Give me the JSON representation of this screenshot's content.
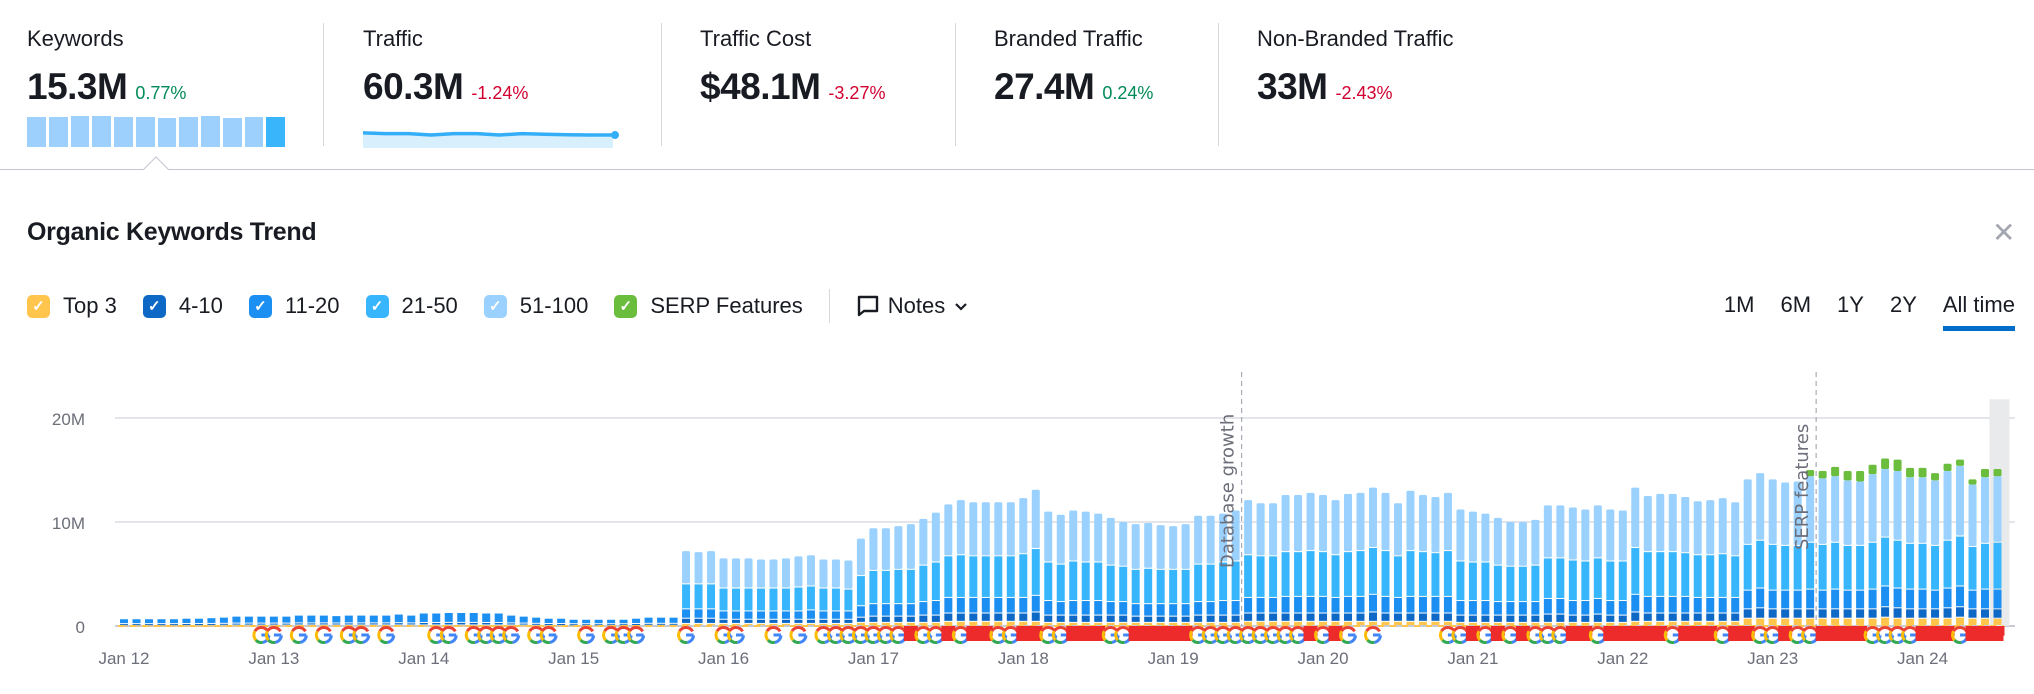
{
  "metrics": [
    {
      "label": "Keywords",
      "value": "15.3M",
      "change": "0.77%",
      "trend": "up",
      "sparkline": [
        0.93,
        0.95,
        0.97,
        0.97,
        0.94,
        0.94,
        0.92,
        0.95,
        0.97,
        0.91,
        0.93,
        0.94
      ]
    },
    {
      "label": "Traffic",
      "value": "60.3M",
      "change": "-1.24%",
      "trend": "down",
      "sparkline": [
        0.92,
        0.9,
        0.9,
        0.86,
        0.9,
        0.9,
        0.86,
        0.9,
        0.88,
        0.87,
        0.86,
        0.86
      ]
    },
    {
      "label": "Traffic Cost",
      "value": "$48.1M",
      "change": "-3.27%",
      "trend": "down"
    },
    {
      "label": "Branded Traffic",
      "value": "27.4M",
      "change": "0.24%",
      "trend": "up"
    },
    {
      "label": "Non-Branded Traffic",
      "value": "33M",
      "change": "-2.43%",
      "trend": "down"
    }
  ],
  "panel": {
    "title": "Organic Keywords Trend",
    "close_icon": "close-icon"
  },
  "legend": [
    {
      "label": "Top 3",
      "color": "#ffc54d",
      "checked": true
    },
    {
      "label": "4-10",
      "color": "#0e68c6",
      "checked": true
    },
    {
      "label": "11-20",
      "color": "#1c8ff2",
      "checked": true
    },
    {
      "label": "21-50",
      "color": "#38b6fd",
      "checked": true
    },
    {
      "label": "51-100",
      "color": "#9ad1fe",
      "checked": true
    },
    {
      "label": "SERP Features",
      "color": "#6bbd3e",
      "checked": true
    }
  ],
  "notes": {
    "label": "Notes",
    "icon": "comment-icon"
  },
  "ranges": [
    {
      "label": "1M"
    },
    {
      "label": "6M"
    },
    {
      "label": "1Y"
    },
    {
      "label": "2Y"
    },
    {
      "label": "All time",
      "active": true
    }
  ],
  "colors": {
    "flag": "#ee2b2b",
    "google_blue": "#4285f4",
    "google_red": "#ea4335",
    "google_yellow": "#fbbc05",
    "google_green": "#34a853"
  },
  "chart_data": {
    "type": "bar",
    "stacked": true,
    "period": "monthly",
    "first_month": "Jan 2012",
    "ylim": [
      0,
      22
    ],
    "y_unit": "M",
    "y_ticks": [
      "0",
      "10M",
      "20M"
    ],
    "x_ticks": [
      "Jan 12",
      "Jan 13",
      "Jan 14",
      "Jan 15",
      "Jan 16",
      "Jan 17",
      "Jan 18",
      "Jan 19",
      "Jan 20",
      "Jan 21",
      "Jan 22",
      "Jan 23",
      "Jan 24"
    ],
    "grid": true,
    "annotations": [
      {
        "label": "Database growth",
        "month": "Jun 2019"
      },
      {
        "label": "SERP features",
        "month": "Apr 2023"
      }
    ],
    "series": [
      {
        "name": "Top 3",
        "values": [
          0.05,
          0.05,
          0.05,
          0.05,
          0.05,
          0.05,
          0.05,
          0.05,
          0.05,
          0.05,
          0.05,
          0.05,
          0.05,
          0.05,
          0.05,
          0.05,
          0.05,
          0.05,
          0.05,
          0.05,
          0.05,
          0.05,
          0.05,
          0.05,
          0.05,
          0.05,
          0.05,
          0.05,
          0.05,
          0.05,
          0.05,
          0.05,
          0.05,
          0.05,
          0.05,
          0.05,
          0.05,
          0.05,
          0.05,
          0.05,
          0.05,
          0.05,
          0.05,
          0.05,
          0.05,
          0.2,
          0.2,
          0.2,
          0.2,
          0.2,
          0.2,
          0.2,
          0.2,
          0.2,
          0.2,
          0.2,
          0.2,
          0.2,
          0.2,
          0.3,
          0.3,
          0.3,
          0.3,
          0.3,
          0.3,
          0.3,
          0.4,
          0.4,
          0.4,
          0.4,
          0.4,
          0.4,
          0.4,
          0.4,
          0.3,
          0.3,
          0.3,
          0.3,
          0.3,
          0.3,
          0.3,
          0.3,
          0.3,
          0.3,
          0.3,
          0.3,
          0.3,
          0.3,
          0.3,
          0.3,
          0.4,
          0.4,
          0.4,
          0.4,
          0.4,
          0.4,
          0.4,
          0.4,
          0.4,
          0.4,
          0.4,
          0.4,
          0.4,
          0.4,
          0.4,
          0.4,
          0.4,
          0.3,
          0.3,
          0.3,
          0.3,
          0.3,
          0.3,
          0.3,
          0.3,
          0.3,
          0.3,
          0.3,
          0.3,
          0.3,
          0.3,
          0.4,
          0.4,
          0.4,
          0.4,
          0.4,
          0.4,
          0.4,
          0.4,
          0.4,
          0.7,
          0.7,
          0.7,
          0.7,
          0.7,
          0.7,
          0.7,
          0.7,
          0.7,
          0.7,
          0.7,
          0.8,
          0.7,
          0.7,
          0.7,
          0.7,
          0.7,
          0.8,
          0.7,
          0.7,
          0.7
        ]
      },
      {
        "name": "4-10",
        "values": [
          0.13,
          0.13,
          0.13,
          0.13,
          0.13,
          0.14,
          0.14,
          0.15,
          0.16,
          0.18,
          0.18,
          0.18,
          0.18,
          0.18,
          0.2,
          0.2,
          0.2,
          0.19,
          0.2,
          0.2,
          0.2,
          0.2,
          0.22,
          0.2,
          0.24,
          0.24,
          0.25,
          0.25,
          0.25,
          0.24,
          0.24,
          0.2,
          0.18,
          0.16,
          0.14,
          0.14,
          0.12,
          0.12,
          0.12,
          0.12,
          0.12,
          0.14,
          0.16,
          0.16,
          0.16,
          0.5,
          0.5,
          0.5,
          0.4,
          0.4,
          0.4,
          0.4,
          0.4,
          0.4,
          0.4,
          0.4,
          0.4,
          0.4,
          0.4,
          0.5,
          0.6,
          0.6,
          0.6,
          0.6,
          0.7,
          0.7,
          0.8,
          0.8,
          0.8,
          0.8,
          0.8,
          0.8,
          0.8,
          0.9,
          0.7,
          0.7,
          0.7,
          0.7,
          0.7,
          0.7,
          0.7,
          0.6,
          0.6,
          0.6,
          0.6,
          0.6,
          0.7,
          0.7,
          0.7,
          0.7,
          0.8,
          0.8,
          0.8,
          0.8,
          0.8,
          0.8,
          0.8,
          0.8,
          0.8,
          0.8,
          0.9,
          0.8,
          0.8,
          0.8,
          0.8,
          0.8,
          0.8,
          0.7,
          0.7,
          0.7,
          0.7,
          0.7,
          0.7,
          0.7,
          0.8,
          0.8,
          0.7,
          0.7,
          0.8,
          0.7,
          0.7,
          0.9,
          0.8,
          0.8,
          0.8,
          0.8,
          0.8,
          0.8,
          0.8,
          0.8,
          0.9,
          1.0,
          0.9,
          0.9,
          0.9,
          0.9,
          0.9,
          0.9,
          0.9,
          0.9,
          0.9,
          1.0,
          1.0,
          0.9,
          0.9,
          0.9,
          1.0,
          1.0,
          0.9,
          0.9,
          0.9
        ]
      },
      {
        "name": "11-20",
        "values": [
          0.47,
          0.47,
          0.47,
          0.47,
          0.47,
          0.51,
          0.51,
          0.55,
          0.59,
          0.67,
          0.67,
          0.67,
          0.67,
          0.67,
          0.75,
          0.75,
          0.75,
          0.71,
          0.75,
          0.75,
          0.75,
          0.75,
          0.83,
          0.75,
          0.91,
          0.91,
          0.95,
          0.95,
          0.95,
          0.91,
          0.91,
          0.75,
          0.67,
          0.59,
          0.51,
          0.51,
          0.43,
          0.43,
          0.43,
          0.43,
          0.43,
          0.51,
          0.59,
          0.59,
          0.59,
          0.9,
          0.9,
          0.9,
          0.8,
          0.8,
          0.8,
          0.8,
          0.8,
          0.8,
          0.8,
          0.9,
          0.8,
          0.8,
          0.8,
          1.1,
          1.2,
          1.2,
          1.2,
          1.2,
          1.3,
          1.4,
          1.5,
          1.5,
          1.5,
          1.5,
          1.5,
          1.5,
          1.5,
          1.6,
          1.4,
          1.3,
          1.4,
          1.4,
          1.4,
          1.3,
          1.3,
          1.2,
          1.2,
          1.2,
          1.2,
          1.2,
          1.3,
          1.3,
          1.4,
          1.4,
          1.5,
          1.5,
          1.5,
          1.6,
          1.6,
          1.6,
          1.6,
          1.5,
          1.6,
          1.6,
          1.7,
          1.6,
          1.5,
          1.6,
          1.6,
          1.6,
          1.6,
          1.4,
          1.4,
          1.4,
          1.3,
          1.3,
          1.3,
          1.3,
          1.5,
          1.5,
          1.4,
          1.4,
          1.5,
          1.4,
          1.4,
          1.7,
          1.6,
          1.6,
          1.6,
          1.6,
          1.5,
          1.5,
          1.5,
          1.5,
          1.8,
          1.9,
          1.8,
          1.8,
          1.8,
          1.9,
          1.8,
          1.9,
          1.8,
          1.8,
          1.9,
          2.0,
          1.9,
          1.9,
          1.9,
          1.8,
          1.9,
          2.0,
          1.8,
          1.9,
          1.9
        ]
      },
      {
        "name": "21-50",
        "values": [
          0,
          0,
          0,
          0,
          0,
          0,
          0,
          0,
          0,
          0,
          0,
          0,
          0,
          0,
          0,
          0,
          0,
          0,
          0,
          0,
          0,
          0,
          0,
          0,
          0,
          0,
          0,
          0,
          0,
          0,
          0,
          0,
          0,
          0,
          0,
          0,
          0,
          0,
          0,
          0,
          0,
          0,
          0,
          0,
          0,
          2.4,
          2.4,
          2.4,
          2.2,
          2.2,
          2.2,
          2.2,
          2.2,
          2.2,
          2.3,
          2.3,
          2.2,
          2.2,
          2.1,
          2.9,
          3.2,
          3.2,
          3.3,
          3.3,
          3.5,
          3.7,
          4.0,
          4.1,
          4.0,
          4.0,
          4.0,
          4.0,
          4.2,
          4.5,
          3.7,
          3.6,
          3.8,
          3.7,
          3.7,
          3.5,
          3.4,
          3.3,
          3.4,
          3.3,
          3.3,
          3.3,
          3.6,
          3.6,
          3.7,
          3.8,
          4.1,
          4.0,
          4.0,
          4.3,
          4.3,
          4.4,
          4.3,
          4.1,
          4.3,
          4.4,
          4.5,
          4.4,
          4.0,
          4.4,
          4.3,
          4.2,
          4.4,
          3.8,
          3.7,
          3.7,
          3.5,
          3.4,
          3.4,
          3.5,
          3.9,
          3.9,
          3.9,
          3.8,
          3.9,
          3.8,
          3.8,
          4.5,
          4.3,
          4.3,
          4.3,
          4.2,
          4.1,
          4.1,
          4.2,
          4.0,
          4.4,
          4.6,
          4.4,
          4.3,
          4.3,
          4.5,
          4.4,
          4.5,
          4.3,
          4.3,
          4.5,
          4.7,
          4.6,
          4.4,
          4.4,
          4.3,
          4.6,
          4.8,
          4.2,
          4.4,
          4.5
        ]
      },
      {
        "name": "51-100",
        "values": [
          0,
          0,
          0,
          0,
          0,
          0,
          0,
          0,
          0,
          0,
          0,
          0,
          0,
          0,
          0,
          0,
          0,
          0,
          0,
          0,
          0,
          0,
          0,
          0,
          0,
          0,
          0,
          0,
          0,
          0,
          0,
          0,
          0,
          0,
          0,
          0,
          0,
          0,
          0,
          0,
          0,
          0,
          0,
          0,
          0,
          3.2,
          3.1,
          3.2,
          2.9,
          2.9,
          2.9,
          2.8,
          2.8,
          2.9,
          3.0,
          3.0,
          2.8,
          2.8,
          2.8,
          3.6,
          4.1,
          4.1,
          4.2,
          4.4,
          4.5,
          4.8,
          5.0,
          5.3,
          5.2,
          5.2,
          5.2,
          5.2,
          5.4,
          5.7,
          4.9,
          4.8,
          4.9,
          4.9,
          4.7,
          4.6,
          4.3,
          4.4,
          4.4,
          4.3,
          4.2,
          4.4,
          4.7,
          4.7,
          4.7,
          4.9,
          5.3,
          5.1,
          5.1,
          5.5,
          5.5,
          5.6,
          5.5,
          5.3,
          5.6,
          5.6,
          5.8,
          5.6,
          5.1,
          5.8,
          5.5,
          5.4,
          5.6,
          5.0,
          4.9,
          4.7,
          4.6,
          4.3,
          4.3,
          4.4,
          5.1,
          5.1,
          5.1,
          5.0,
          5.1,
          5.0,
          4.9,
          5.8,
          5.4,
          5.6,
          5.6,
          5.4,
          5.2,
          5.3,
          5.4,
          5.2,
          6.3,
          6.5,
          6.3,
          6.1,
          6.2,
          6.4,
          6.4,
          6.4,
          6.3,
          6.2,
          6.6,
          6.6,
          6.7,
          6.4,
          6.4,
          6.3,
          6.7,
          6.8,
          6.0,
          6.4,
          6.4
        ]
      },
      {
        "name": "SERP Features",
        "values": [
          0,
          0,
          0,
          0,
          0,
          0,
          0,
          0,
          0,
          0,
          0,
          0,
          0,
          0,
          0,
          0,
          0,
          0,
          0,
          0,
          0,
          0,
          0,
          0,
          0,
          0,
          0,
          0,
          0,
          0,
          0,
          0,
          0,
          0,
          0,
          0,
          0,
          0,
          0,
          0,
          0,
          0,
          0,
          0,
          0,
          0,
          0,
          0,
          0,
          0,
          0,
          0,
          0,
          0,
          0,
          0,
          0,
          0,
          0,
          0,
          0,
          0,
          0,
          0,
          0,
          0,
          0,
          0,
          0,
          0,
          0,
          0,
          0,
          0,
          0,
          0,
          0,
          0,
          0,
          0,
          0,
          0,
          0,
          0,
          0,
          0,
          0,
          0,
          0,
          0,
          0,
          0,
          0,
          0,
          0,
          0,
          0,
          0,
          0,
          0,
          0,
          0,
          0,
          0,
          0,
          0,
          0,
          0,
          0,
          0,
          0,
          0,
          0,
          0,
          0,
          0,
          0,
          0,
          0,
          0,
          0,
          0,
          0,
          0,
          0,
          0,
          0,
          0,
          0,
          0,
          0,
          0,
          0,
          0,
          0,
          0.6,
          0.7,
          0.9,
          0.9,
          1.0,
          0.9,
          1.0,
          1.1,
          0.9,
          0.9,
          0.7,
          0.7,
          0.6,
          0.5,
          0.8,
          0.7
        ]
      }
    ],
    "note_markers_legend": {
      "g": "google-update-icon",
      "f": "flag-icon"
    },
    "note_markers": [
      "",
      "",
      "",
      "",
      "",
      "",
      "",
      "",
      "",
      "",
      "",
      "g",
      "g",
      "",
      "g",
      "",
      "g",
      "",
      "g",
      "g",
      "",
      "g",
      "",
      "",
      "",
      "g",
      "g",
      "",
      "g",
      "g",
      "g",
      "g",
      "",
      "g",
      "g",
      "",
      "",
      "g",
      "",
      "g",
      "g",
      "g",
      "",
      "",
      "",
      "g",
      "",
      "",
      "g",
      "g",
      "",
      "",
      "g",
      "",
      "g",
      "",
      "g",
      "g",
      "g",
      "g",
      "g",
      "g",
      "g",
      "f",
      "g",
      "g",
      "f",
      "g",
      "f",
      "f",
      "g",
      "g",
      "f",
      "f",
      "g",
      "g",
      "f",
      "f",
      "f",
      "g",
      "g",
      "f",
      "f",
      "f",
      "f",
      "f",
      "g",
      "g",
      "g",
      "g",
      "g",
      "g",
      "g",
      "g",
      "g",
      "f",
      "g",
      "f",
      "g",
      "",
      "g",
      "",
      "",
      "",
      "",
      "",
      "g",
      "g",
      "f",
      "g",
      "f",
      "g",
      "f",
      "g",
      "g",
      "g",
      "f",
      "f",
      "g",
      "f",
      "f",
      "f",
      "f",
      "f",
      "g",
      "f",
      "f",
      "f",
      "g",
      "f",
      "f",
      "g",
      "g",
      "f",
      "g",
      "g",
      "f",
      "f",
      "f",
      "f",
      "g",
      "g",
      "g",
      "g",
      "f",
      "f",
      "f",
      "g",
      "f",
      "f",
      "f"
    ]
  }
}
